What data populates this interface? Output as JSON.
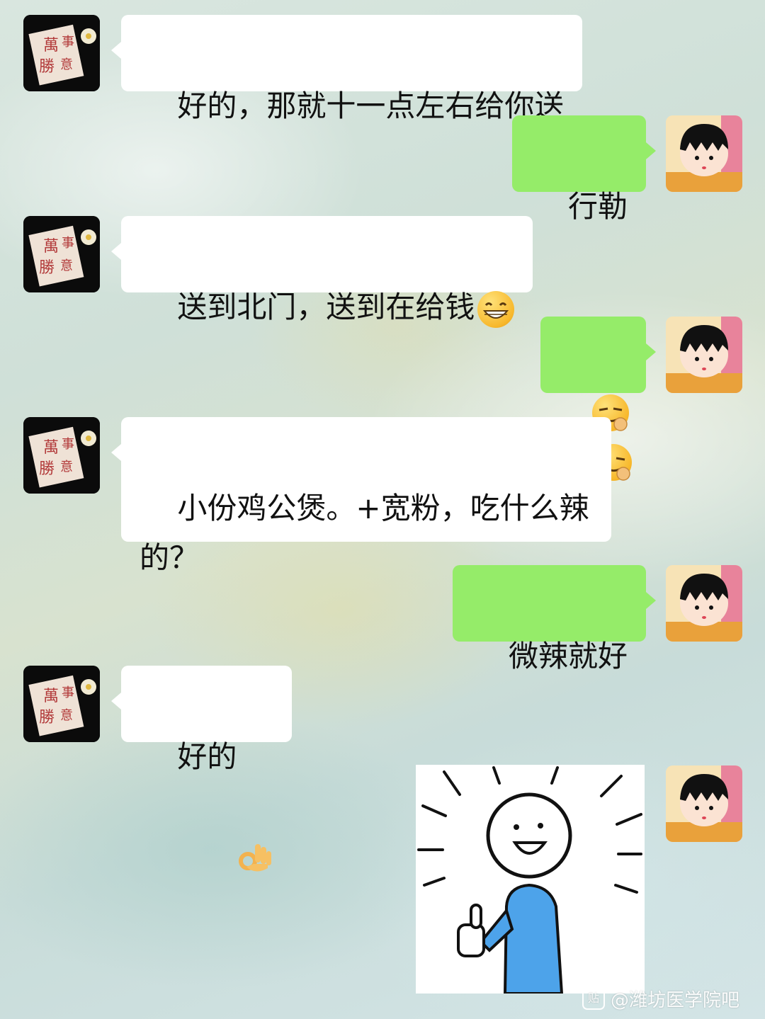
{
  "messages": [
    {
      "side": "left",
      "text": "好的，那就十一点左右给你送"
    },
    {
      "side": "right",
      "text": "行勒"
    },
    {
      "side": "left",
      "text": "送到北门，送到在给钱",
      "emoji": "grinning-face-emoji"
    },
    {
      "side": "right",
      "emojis": [
        "smirk-ok-emoji",
        "smirk-ok-emoji"
      ]
    },
    {
      "side": "left",
      "text": "小份鸡公煲。+宽粉，吃什么辣\n的？"
    },
    {
      "side": "right",
      "text": "微辣就好"
    },
    {
      "side": "left",
      "text": "好的",
      "emoji": "ok-hand-emoji"
    },
    {
      "side": "right",
      "sticker": "thumbs-up-stickman-sticker"
    }
  ],
  "avatars": {
    "left": {
      "icon": "calligraphy-card-avatar",
      "chars": [
        "萬",
        "事",
        "勝",
        "意"
      ]
    },
    "right": {
      "icon": "cartoon-girl-avatar"
    }
  },
  "watermark": {
    "icon_label": "贴",
    "text": "@潍坊医学院吧"
  },
  "colors": {
    "sent_bubble": "#95ec69",
    "received_bubble": "#ffffff"
  }
}
